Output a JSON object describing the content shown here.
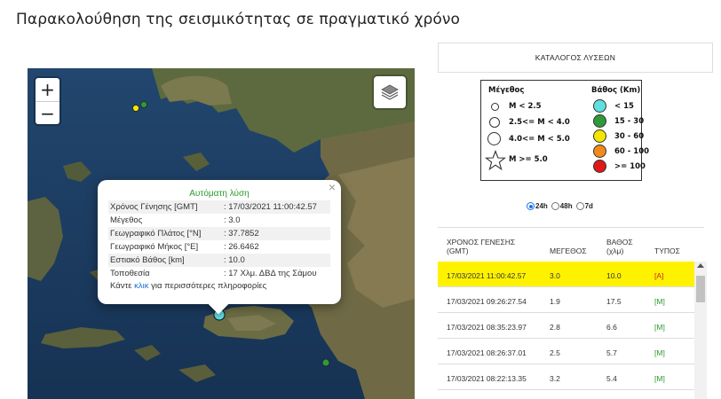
{
  "page": {
    "title": "Παρακολούθηση της σεισμικότητας σε πραγματικό χρόνο"
  },
  "map": {
    "zoom_in": "+",
    "zoom_out": "−",
    "layers_icon": "layers-icon",
    "popup": {
      "title": "Αυτόματη λύση",
      "close": "×",
      "rows": [
        {
          "label": "Χρόνος Γένησης [GMT]",
          "value": ": 17/03/2021 11:00:42.57"
        },
        {
          "label": "Μέγεθος",
          "value": ": 3.0"
        },
        {
          "label": "Γεωγραφικό Πλάτος [°N]",
          "value": ": 37.7852"
        },
        {
          "label": "Γεωγραφικό Μήκος [°E]",
          "value": ": 26.6462"
        },
        {
          "label": "Εστιακό Βάθος [km]",
          "value": ": 10.0"
        },
        {
          "label": "Τοποθεσία",
          "value": ": 17 Χλμ. ΔΒΔ της Σάμου"
        }
      ],
      "more_pre": "Κάντε ",
      "more_link": "κλικ",
      "more_post": " για περισσότερες πληροφορίες"
    }
  },
  "panel": {
    "catalog_title": "ΚΑΤΑΛΟΓΟΣ ΛΥΣΕΩΝ",
    "legend": {
      "magnitude_title": "Μέγεθος",
      "depth_title": "Βάθος (Km)",
      "magnitudes": [
        "M < 2.5",
        "2.5<= M < 4.0",
        "4.0<= M < 5.0",
        "M >= 5.0"
      ],
      "depths": [
        {
          "label": "< 15",
          "color": "#5ee0e0"
        },
        {
          "label": "15 - 30",
          "color": "#2e9a3a"
        },
        {
          "label": "30 - 60",
          "color": "#f5e600"
        },
        {
          "label": "60 - 100",
          "color": "#f08a1c"
        },
        {
          "label": ">= 100",
          "color": "#e01818"
        }
      ]
    },
    "range": {
      "options": [
        "24h",
        "48h",
        "7d"
      ],
      "selected": "24h"
    },
    "table": {
      "headers": {
        "time_1": "ΧΡΟΝΟΣ ΓΕΝΕΣΗΣ",
        "time_2": "(GMT)",
        "magnitude": "ΜΕΓΕΘΟΣ",
        "depth_1": "ΒΑΘΟΣ",
        "depth_2": "(χλμ)",
        "type": "ΤΥΠΟΣ"
      },
      "rows": [
        {
          "time": "17/03/2021 11:00:42.57",
          "mag": "3.0",
          "depth": "10.0",
          "type": "[A]"
        },
        {
          "time": "17/03/2021 09:26:27.54",
          "mag": "1.9",
          "depth": "17.5",
          "type": "[M]"
        },
        {
          "time": "17/03/2021 08:35:23.97",
          "mag": "2.8",
          "depth": "6.6",
          "type": "[M]"
        },
        {
          "time": "17/03/2021 08:26:37.01",
          "mag": "2.5",
          "depth": "5.7",
          "type": "[M]"
        },
        {
          "time": "17/03/2021 08:22:13.35",
          "mag": "3.2",
          "depth": "5.4",
          "type": "[M]"
        }
      ]
    }
  }
}
